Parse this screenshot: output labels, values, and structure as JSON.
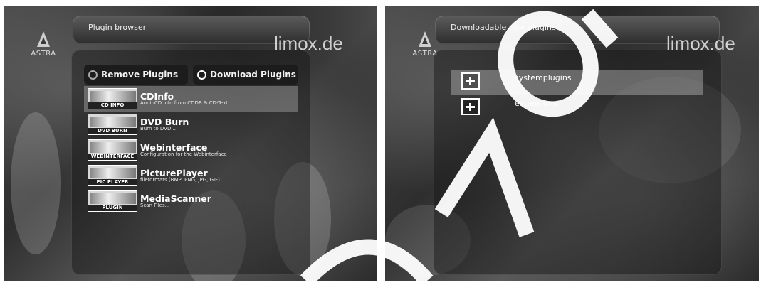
{
  "left_screen": {
    "logo_text": "ASTRA",
    "title": "Plugin browser",
    "watermark": "limox.de",
    "tabs": [
      {
        "label": "Remove Plugins"
      },
      {
        "label": "Download Plugins"
      }
    ],
    "plugins": [
      {
        "name": "CDInfo",
        "description": "AudioCD info from CDDB & CD-Text",
        "icon_label": "CD INFO",
        "icon": "cd-info-icon"
      },
      {
        "name": "DVD Burn",
        "description": "Burn to DVD...",
        "icon_label": "DVD BURN",
        "icon": "dvd-burn-icon"
      },
      {
        "name": "Webinterface",
        "description": "Configuration for the Webinterface",
        "icon_label": "WEBINTERFACE",
        "icon": "webinterface-icon"
      },
      {
        "name": "PicturePlayer",
        "description": "fileformats (BMP, PNG, JPG, GIF)",
        "icon_label": "PIC PLAYER",
        "icon": "pic-player-icon"
      },
      {
        "name": "MediaScanner",
        "description": "Scan Files...",
        "icon_label": "PLUGIN",
        "icon": "plugin-icon"
      }
    ]
  },
  "right_screen": {
    "logo_text": "ASTRA",
    "title": "Downloadable new plugins",
    "watermark": "limox.de",
    "categories": [
      {
        "label": "systemplugins"
      },
      {
        "label": "extensions"
      }
    ]
  }
}
